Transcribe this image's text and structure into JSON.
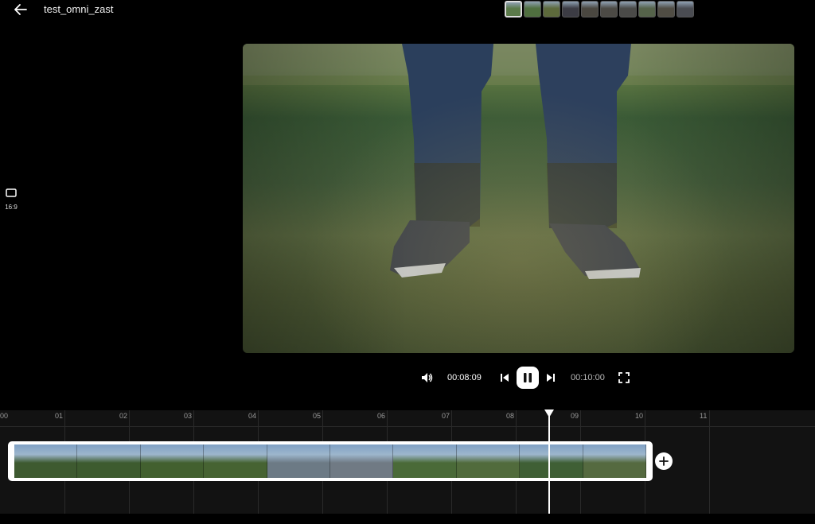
{
  "header": {
    "back_icon": "arrow-left-icon",
    "title": "test_omni_zast"
  },
  "thumbnails": [
    {
      "color": "#5b7a4a",
      "selected": true
    },
    {
      "color": "#4f6f3f",
      "selected": false
    },
    {
      "color": "#5d6a3c",
      "selected": false
    },
    {
      "color": "#3c3c44",
      "selected": false
    },
    {
      "color": "#4a4740",
      "selected": false
    },
    {
      "color": "#4c4a45",
      "selected": false
    },
    {
      "color": "#4a4a48",
      "selected": false
    },
    {
      "color": "#55634a",
      "selected": false
    },
    {
      "color": "#504d44",
      "selected": false
    },
    {
      "color": "#4a4c52",
      "selected": false
    }
  ],
  "aspect_ratio": {
    "icon": "rectangle-icon",
    "label": "16:9"
  },
  "player": {
    "current_time": "00:08:09",
    "total_time": "00:10:00",
    "state": "playing"
  },
  "timeline": {
    "ticks": [
      "00",
      "01",
      "02",
      "03",
      "04",
      "05",
      "06",
      "07",
      "08",
      "09",
      "10",
      "11"
    ],
    "frame_colors": [
      "#3e5a30",
      "#3d5b2f",
      "#42602f",
      "#466332",
      "#6c7a85",
      "#707a84",
      "#4a6a38",
      "#516b3c",
      "#3f5f35",
      "#556a40"
    ],
    "add_icon": "plus-icon"
  }
}
